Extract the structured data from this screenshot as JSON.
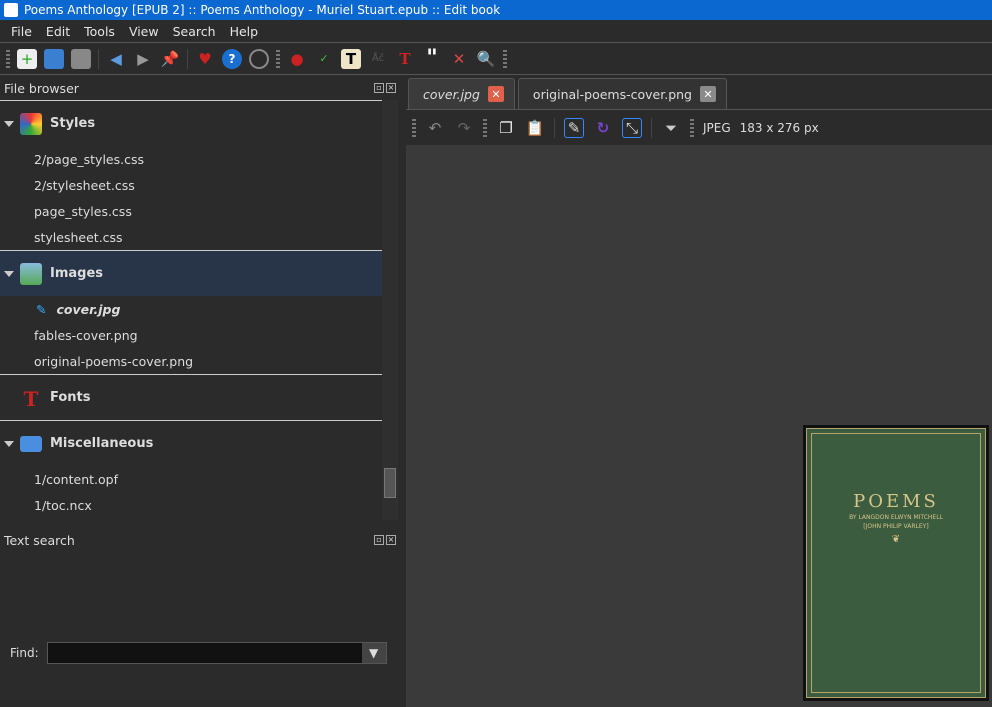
{
  "window": {
    "title": "Poems Anthology [EPUB 2] :: Poems Anthology - Muriel Stuart.epub :: Edit book"
  },
  "menu": [
    "File",
    "Edit",
    "Tools",
    "View",
    "Search",
    "Help"
  ],
  "toolbar": {
    "icons": [
      "new-file-icon",
      "import-icon",
      "save-icon",
      "back-icon",
      "forward-icon",
      "checkpoint-icon",
      "donate-heart-icon",
      "help-icon",
      "preferences-icon",
      "check-book-icon",
      "spellcheck-icon",
      "text-icon",
      "transliterate-icon",
      "fonts-icon",
      "quote-icon",
      "remove-unused-icon",
      "reports-icon"
    ]
  },
  "file_browser": {
    "title": "File browser",
    "groups": [
      {
        "label": "Styles",
        "items": [
          "2/page_styles.css",
          "2/stylesheet.css",
          "page_styles.css",
          "stylesheet.css"
        ]
      },
      {
        "label": "Images",
        "items": [
          "cover.jpg",
          "fables-cover.png",
          "original-poems-cover.png"
        ]
      },
      {
        "label": "Fonts",
        "items": []
      },
      {
        "label": "Miscellaneous",
        "items": [
          "1/content.opf",
          "1/toc.ncx"
        ]
      }
    ]
  },
  "text_search": {
    "title": "Text search",
    "find_label": "Find:",
    "find_value": ""
  },
  "tabs": [
    {
      "label": "cover.jpg",
      "active": true
    },
    {
      "label": "original-poems-cover.png",
      "active": false
    }
  ],
  "image_toolbar": {
    "format": "JPEG",
    "size": "183 x 276 px"
  },
  "cover": {
    "title": "POEMS",
    "line1": "BY LANGDON ELWYN MITCHELL",
    "line2": "[JOHN PHILIP VARLEY]"
  },
  "colors": {
    "titlebar": "#0b68d0",
    "close_active": "#e0604a",
    "close_inactive": "#8a8a8a"
  }
}
